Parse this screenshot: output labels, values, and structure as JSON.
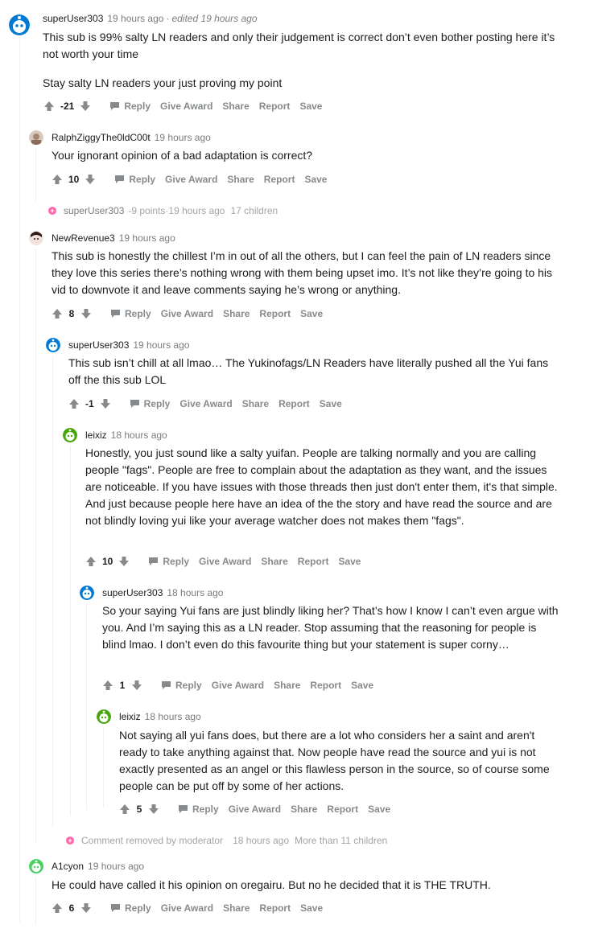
{
  "actions": {
    "reply": "Reply",
    "give_award": "Give Award",
    "share": "Share",
    "report": "Report",
    "save": "Save"
  },
  "comments": [
    {
      "user": "superUser303",
      "time": "19 hours ago",
      "edited": "edited 19 hours ago",
      "paragraphs": [
        "This sub is 99% salty LN readers and only their judgement is correct don’t even bother posting here it’s not worth your time",
        "Stay salty LN readers your just proving my point"
      ],
      "score": "-21"
    },
    {
      "user": "RalphZiggyThe0ldC00t",
      "time": "19 hours ago",
      "paragraphs": [
        "Your ignorant opinion of a bad adaptation is correct?"
      ],
      "score": "10"
    },
    {
      "user": "NewRevenue3",
      "time": "19 hours ago",
      "paragraphs": [
        "This sub is honestly the chillest I’m in out of all the others, but I can feel the pain of LN readers since they love this series there’s nothing wrong with them being upset imo. It’s not like they’re going to his vid to downvote it and leave comments saying he’s wrong or anything."
      ],
      "score": "8"
    },
    {
      "user": "superUser303",
      "time": "19 hours ago",
      "paragraphs": [
        "This sub isn’t chill at all lmao… The Yukinofags/LN Readers have literally pushed all the Yui fans off the this sub LOL"
      ],
      "score": "-1"
    },
    {
      "user": "leixiz",
      "time": "18 hours ago",
      "paragraphs": [
        "Honestly, you just sound like a salty yuifan. People are talking normally and you are calling people \"fags\". People are free to complain about the adaptation as they want, and the issues are noticeable. If you have issues with those threads then just don't enter them, it's that simple. And just because people here have an idea of the the story and have read the source and are not blindly loving yui like your average watcher does not makes them \"fags\"."
      ],
      "score": "10"
    },
    {
      "user": "superUser303",
      "time": "18 hours ago",
      "paragraphs": [
        "So your saying Yui fans are just blindly liking her? That’s how I know I can’t even argue with you. And I’m saying this as a LN reader. Stop assuming that the reasoning for people is blind lmao. I don’t even do this favourite thing but your statement is super corny…"
      ],
      "score": "1"
    },
    {
      "user": "leixiz",
      "time": "18 hours ago",
      "paragraphs": [
        "Not saying all yui fans does, but there are a lot who considers her a saint and aren't ready to take anything against that. Now people have read the source and yui is not exactly presented as an angel or this flawless person in the source, so of course some people can be put off by some of her actions."
      ],
      "score": "5"
    },
    {
      "user": "A1cyon",
      "time": "19 hours ago",
      "paragraphs": [
        "He could have called it his opinion on oregairu. But no he decided that it is THE TRUTH."
      ],
      "score": "6"
    }
  ],
  "collapsed": [
    {
      "user": "superUser303",
      "points": "-9 points",
      "time": "19 hours ago",
      "children": "17 children"
    },
    {
      "label": "Comment removed by moderator",
      "time": "18 hours ago",
      "children": "More than 11 children"
    }
  ],
  "colors": {
    "accent_plus": "#ff66ac",
    "meta_gray": "#7c7c7c",
    "action_gray": "#878a8c",
    "thread_line": "#edeff1"
  }
}
